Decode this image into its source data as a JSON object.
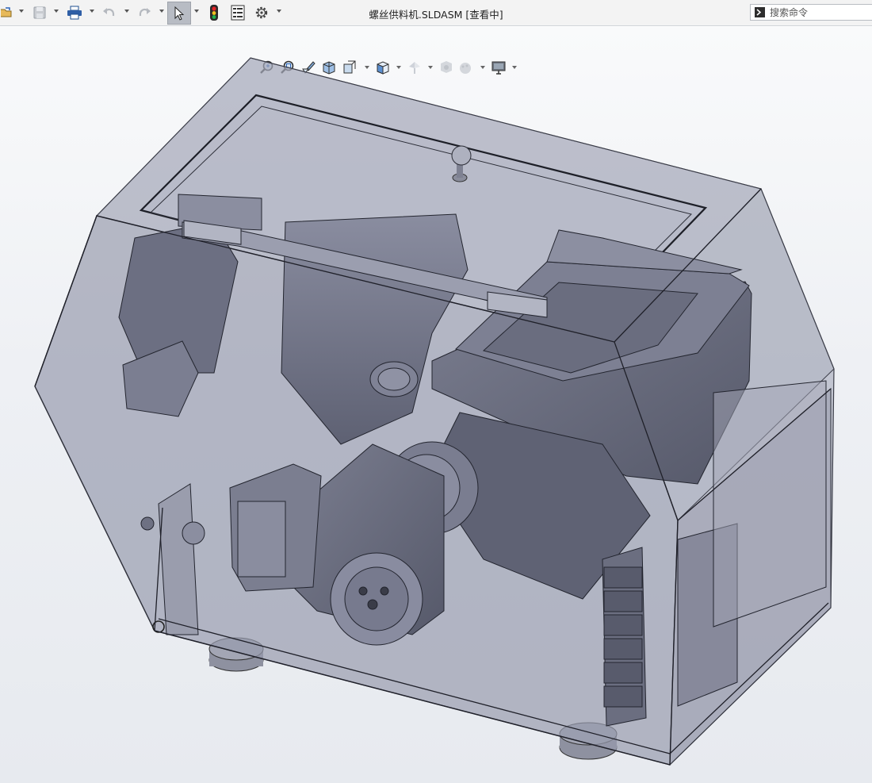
{
  "window": {
    "title": "螺丝供料机.SLDASM [查看中]"
  },
  "toolbar": {
    "items": [
      {
        "name": "open-icon",
        "has_dropdown": true
      },
      {
        "name": "save-icon",
        "has_dropdown": true,
        "disabled": true
      },
      {
        "name": "print-icon",
        "has_dropdown": true
      },
      {
        "name": "undo-icon",
        "has_dropdown": true,
        "disabled": true
      },
      {
        "name": "redo-icon",
        "has_dropdown": true,
        "disabled": true
      },
      {
        "name": "select-icon",
        "has_dropdown": true,
        "active": true
      },
      {
        "name": "rebuild-icon"
      },
      {
        "name": "file-properties-icon"
      },
      {
        "name": "options-icon",
        "has_dropdown": true
      }
    ]
  },
  "search": {
    "placeholder": "搜索命令"
  },
  "heads_up_toolbar": {
    "items": [
      "zoom-to-fit-icon",
      "zoom-to-area-icon",
      "previous-view-icon",
      "section-view-icon",
      "dynamic-annotation-icon",
      "view-orientation-icon",
      "display-style-icon",
      "hide-show-items-icon",
      "edit-appearance-icon",
      "apply-scene-icon",
      "view-settings-icon"
    ]
  },
  "colors": {
    "accent": "#c0202a",
    "enclosure_fill": "#9599ac",
    "part_fill": "#6b6e80",
    "edge": "#222430"
  }
}
